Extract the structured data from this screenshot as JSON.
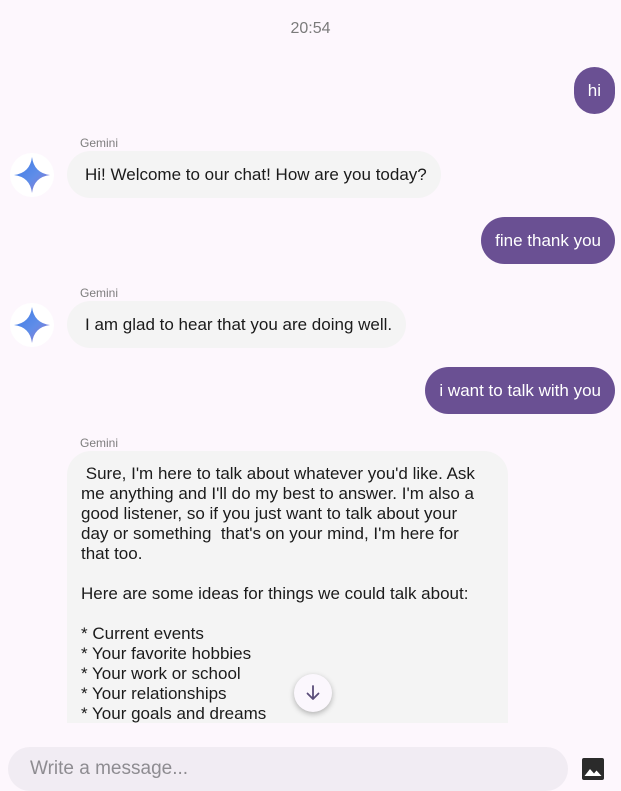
{
  "chat": {
    "timestamp": "20:54",
    "messages": [
      {
        "role": "user",
        "text": "hi"
      },
      {
        "role": "bot",
        "sender": "Gemini",
        "text": "Hi! Welcome to our chat! How are you today?"
      },
      {
        "role": "user",
        "text": "fine thank you"
      },
      {
        "role": "bot",
        "sender": "Gemini",
        "text": "I am glad to hear that you are doing well."
      },
      {
        "role": "user",
        "text": "i want to talk with you"
      },
      {
        "role": "bot",
        "sender": "Gemini",
        "text": " Sure, I'm here to talk about whatever you'd like. Ask\nme anything and I'll do my best to answer. I'm also a\ngood listener, so if you just want to talk about your\nday or something  that's on your mind, I'm here for\nthat too.\n\nHere are some ideas for things we could talk about:\n\n* Current events\n* Your favorite hobbies\n* Your work or school\n* Your relationships\n* Your goals and dreams"
      }
    ]
  },
  "composer": {
    "placeholder": "Write a message...",
    "image_icon": "image-icon"
  },
  "icons": {
    "avatar": "gemini-sparkle-icon",
    "scroll": "arrow-down-icon"
  },
  "colors": {
    "user_bubble": "#6a5093",
    "bot_bubble": "#f4f4f4",
    "background": "#fdf7fd"
  }
}
